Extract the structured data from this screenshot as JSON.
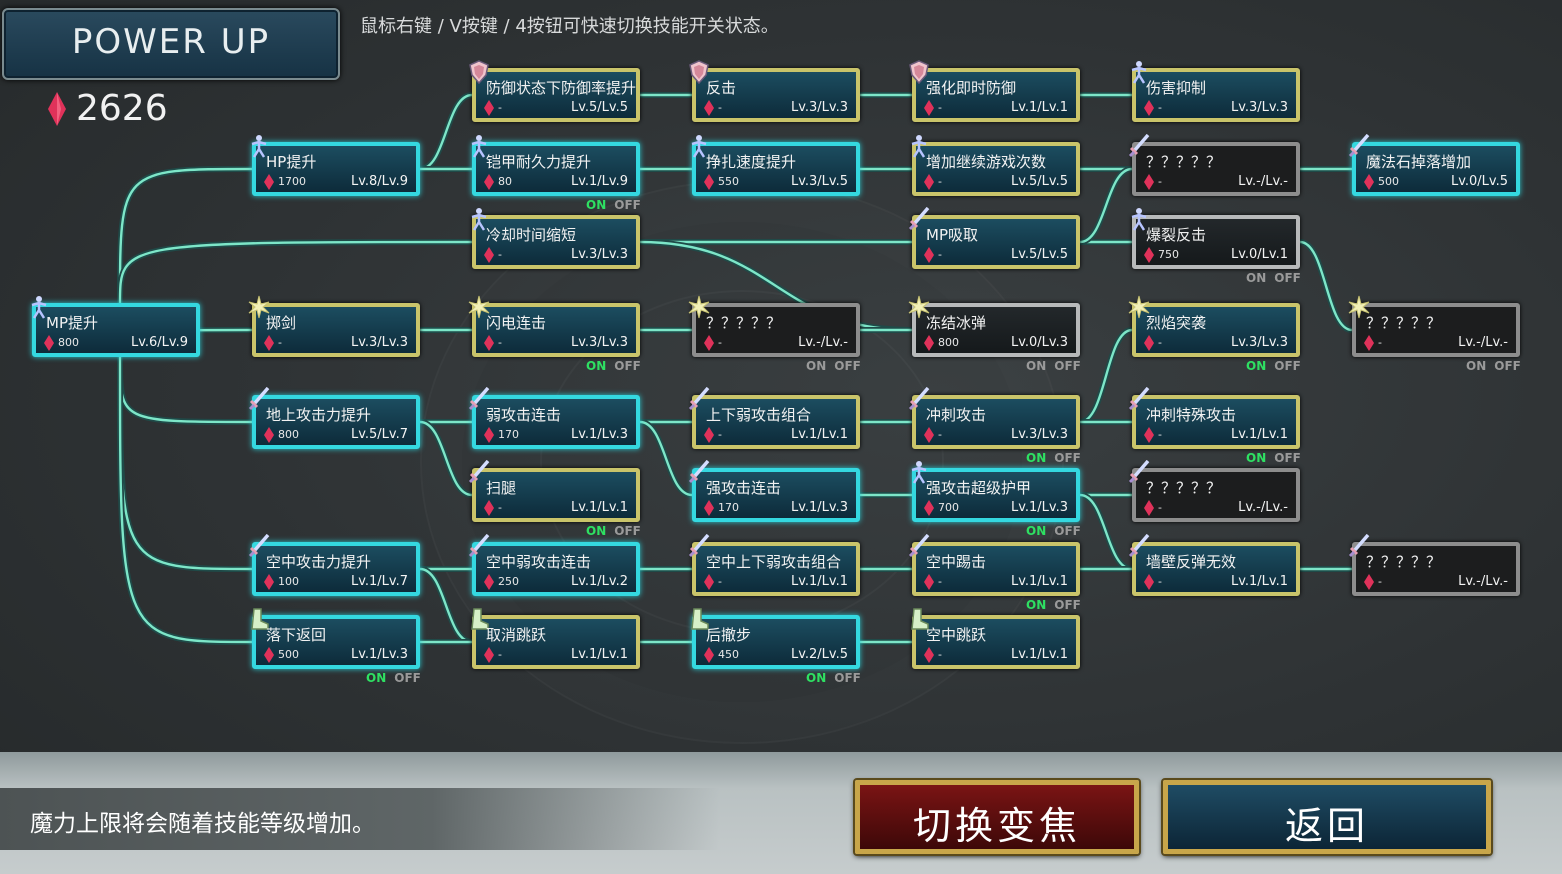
{
  "header": {
    "title": "POWER UP",
    "hint": "鼠标右键 / V按键 / 4按钮可快速切换技能开关状态。"
  },
  "mana": {
    "value": "2626"
  },
  "toggle": {
    "on": "ON",
    "off": "OFF"
  },
  "colors": {
    "link": "#7de6c8",
    "border_gold": "#c9c46a",
    "border_cyan": "#34d8e0",
    "gem": "#e0325a"
  },
  "nodes": [
    {
      "name": "防御状态下防御率提升",
      "cost": "-",
      "level": "Lv.5/Lv.5",
      "icon": "shield-icon"
    },
    {
      "name": "反击",
      "cost": "-",
      "level": "Lv.3/Lv.3",
      "icon": "shield-icon"
    },
    {
      "name": "强化即时防御",
      "cost": "-",
      "level": "Lv.1/Lv.1",
      "icon": "shield-icon"
    },
    {
      "name": "伤害抑制",
      "cost": "-",
      "level": "Lv.3/Lv.3",
      "icon": "figure-icon"
    },
    {
      "name": "HP提升",
      "cost": "1700",
      "level": "Lv.8/Lv.9",
      "icon": "figure-icon"
    },
    {
      "name": "铠甲耐久力提升",
      "cost": "80",
      "level": "Lv.1/Lv.9",
      "icon": "figure-icon"
    },
    {
      "name": "挣扎速度提升",
      "cost": "550",
      "level": "Lv.3/Lv.5",
      "icon": "figure-icon"
    },
    {
      "name": "增加继续游戏次数",
      "cost": "-",
      "level": "Lv.5/Lv.5",
      "icon": "figure-icon"
    },
    {
      "name": "？？？？？",
      "cost": "-",
      "level": "Lv.-/Lv.-",
      "icon": "sword-icon"
    },
    {
      "name": "魔法石掉落增加",
      "cost": "500",
      "level": "Lv.0/Lv.5",
      "icon": "sword-icon"
    },
    {
      "name": "冷却时间缩短",
      "cost": "-",
      "level": "Lv.3/Lv.3",
      "icon": "figure-icon"
    },
    {
      "name": "MP吸取",
      "cost": "-",
      "level": "Lv.5/Lv.5",
      "icon": "sword-icon"
    },
    {
      "name": "爆裂反击",
      "cost": "750",
      "level": "Lv.0/Lv.1",
      "icon": "figure-icon"
    },
    {
      "name": "MP提升",
      "cost": "800",
      "level": "Lv.6/Lv.9",
      "icon": "figure-icon"
    },
    {
      "name": "掷剑",
      "cost": "-",
      "level": "Lv.3/Lv.3",
      "icon": "burst-icon"
    },
    {
      "name": "闪电连击",
      "cost": "-",
      "level": "Lv.3/Lv.3",
      "icon": "burst-icon"
    },
    {
      "name": "？？？？？",
      "cost": "-",
      "level": "Lv.-/Lv.-",
      "icon": "burst-icon"
    },
    {
      "name": "冻结冰弹",
      "cost": "800",
      "level": "Lv.0/Lv.3",
      "icon": "burst-icon"
    },
    {
      "name": "烈焰突袭",
      "cost": "-",
      "level": "Lv.3/Lv.3",
      "icon": "burst-icon"
    },
    {
      "name": "？？？？？",
      "cost": "-",
      "level": "Lv.-/Lv.-",
      "icon": "burst-icon"
    },
    {
      "name": "地上攻击力提升",
      "cost": "800",
      "level": "Lv.5/Lv.7",
      "icon": "sword-icon"
    },
    {
      "name": "弱攻击连击",
      "cost": "170",
      "level": "Lv.1/Lv.3",
      "icon": "sword-icon"
    },
    {
      "name": "上下弱攻击组合",
      "cost": "-",
      "level": "Lv.1/Lv.1",
      "icon": "sword-icon"
    },
    {
      "name": "冲刺攻击",
      "cost": "-",
      "level": "Lv.3/Lv.3",
      "icon": "sword-icon"
    },
    {
      "name": "冲刺特殊攻击",
      "cost": "-",
      "level": "Lv.1/Lv.1",
      "icon": "sword-icon"
    },
    {
      "name": "扫腿",
      "cost": "-",
      "level": "Lv.1/Lv.1",
      "icon": "sword-icon"
    },
    {
      "name": "强攻击连击",
      "cost": "170",
      "level": "Lv.1/Lv.3",
      "icon": "sword-icon"
    },
    {
      "name": "强攻击超级护甲",
      "cost": "700",
      "level": "Lv.1/Lv.3",
      "icon": "figure-icon"
    },
    {
      "name": "？？？？？",
      "cost": "-",
      "level": "Lv.-/Lv.-",
      "icon": "sword-icon"
    },
    {
      "name": "空中攻击力提升",
      "cost": "100",
      "level": "Lv.1/Lv.7",
      "icon": "sword-icon"
    },
    {
      "name": "空中弱攻击连击",
      "cost": "250",
      "level": "Lv.1/Lv.2",
      "icon": "sword-icon"
    },
    {
      "name": "空中上下弱攻击组合",
      "cost": "-",
      "level": "Lv.1/Lv.1",
      "icon": "sword-icon"
    },
    {
      "name": "空中踢击",
      "cost": "-",
      "level": "Lv.1/Lv.1",
      "icon": "sword-icon"
    },
    {
      "name": "墙壁反弹无效",
      "cost": "-",
      "level": "Lv.1/Lv.1",
      "icon": "sword-icon"
    },
    {
      "name": "？？？？？",
      "cost": "-",
      "level": "Lv.-/Lv.-",
      "icon": "sword-icon"
    },
    {
      "name": "落下返回",
      "cost": "500",
      "level": "Lv.1/Lv.3",
      "icon": "boot-icon"
    },
    {
      "name": "取消跳跃",
      "cost": "-",
      "level": "Lv.1/Lv.1",
      "icon": "boot-icon"
    },
    {
      "name": "后撤步",
      "cost": "450",
      "level": "Lv.2/Lv.5",
      "icon": "boot-icon"
    },
    {
      "name": "空中跳跃",
      "cost": "-",
      "level": "Lv.1/Lv.1",
      "icon": "boot-icon"
    }
  ],
  "footer": {
    "message": "魔力上限将会随着技能等级增加。",
    "switch_focus_label": "切换变焦",
    "back_label": "返回"
  }
}
